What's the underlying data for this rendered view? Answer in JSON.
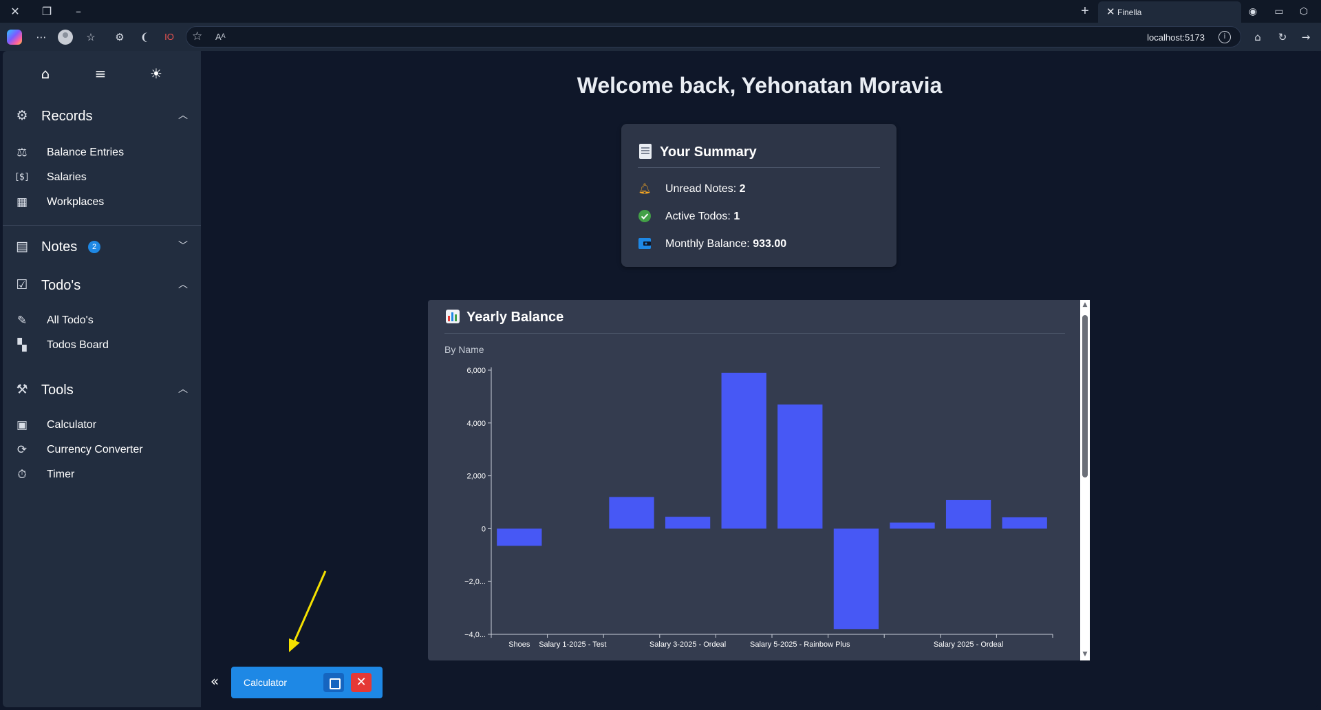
{
  "browser": {
    "tab_title": "Finella",
    "url": "localhost:5173"
  },
  "sidebar": {
    "sections": [
      {
        "label": "Records",
        "icon": "records-icon",
        "expanded": true,
        "items": [
          {
            "label": "Balance Entries",
            "icon": "scale-icon"
          },
          {
            "label": "Salaries",
            "icon": "dollar-bill-icon"
          },
          {
            "label": "Workplaces",
            "icon": "building-icon"
          }
        ]
      },
      {
        "label": "Notes",
        "icon": "notes-icon",
        "expanded": false,
        "badge": "2",
        "items": []
      },
      {
        "label": "Todo's",
        "icon": "checklist-icon",
        "expanded": true,
        "items": [
          {
            "label": "All Todo's",
            "icon": "edit-list-icon"
          },
          {
            "label": "Todos Board",
            "icon": "grid-add-icon"
          }
        ]
      },
      {
        "label": "Tools",
        "icon": "tools-icon",
        "expanded": true,
        "items": [
          {
            "label": "Calculator",
            "icon": "calculator-icon"
          },
          {
            "label": "Currency Converter",
            "icon": "currency-exchange-icon"
          },
          {
            "label": "Timer",
            "icon": "timer-icon"
          }
        ]
      }
    ]
  },
  "main": {
    "welcome": "Welcome back, Yehonatan Moravia",
    "summary": {
      "title": "Your Summary",
      "rows": [
        {
          "label": "Unread Notes: ",
          "value": "2",
          "icon": "bell-icon",
          "color": "#f5a623"
        },
        {
          "label": "Active Todos: ",
          "value": "1",
          "icon": "check-circle-icon",
          "color": "#43a047"
        },
        {
          "label": "Monthly Balance: ",
          "value": "933.00",
          "icon": "wallet-icon",
          "color": "#1e88e5"
        }
      ]
    },
    "chart_card": {
      "title": "Yearly Balance",
      "subtitle": "By Name"
    }
  },
  "chart_data": {
    "type": "bar",
    "x_tick_labels": [
      "Shoes",
      "Salary 1-2025 - Test",
      "",
      "Salary 3-2025 - Ordeal",
      "",
      "Salary 5-2025 - Rainbow Plus",
      "",
      "",
      "Salary 2025 - Ordeal",
      ""
    ],
    "values": [
      -650,
      0,
      1200,
      450,
      5900,
      4700,
      -3800,
      230,
      1080,
      430
    ],
    "y_tick_labels": [
      "6,000",
      "4,000",
      "2,000",
      "0",
      "−2,0...",
      "−4,0..."
    ],
    "ylim": [
      -4000,
      6000
    ],
    "bar_color": "#4758f5",
    "grid": false
  },
  "floating": {
    "calculator_label": "Calculator"
  }
}
